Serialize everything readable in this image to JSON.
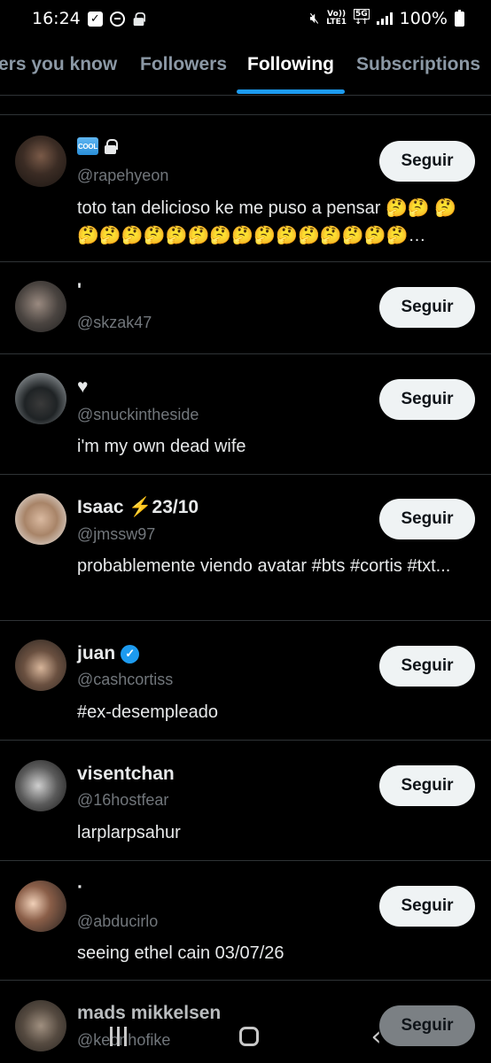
{
  "status_bar": {
    "time": "16:24",
    "lte_top": "Vo))",
    "lte_bottom": "LTE1",
    "network": "5G",
    "battery": "100%"
  },
  "tabs": [
    {
      "label": "ers you know"
    },
    {
      "label": "Followers"
    },
    {
      "label": "Following",
      "active": true
    },
    {
      "label": "Subscriptions"
    }
  ],
  "follow_label": "Seguir",
  "users": [
    {
      "name": "",
      "badge": "COOL",
      "locked": true,
      "handle": "@rapehyeon",
      "bio": "toto tan delicioso ke me puso a pensar 🤔🤔 🤔🤔🤔🤔🤔🤔🤔🤔🤔🤔🤔🤔🤔🤔🤔🤔…"
    },
    {
      "name": "'",
      "handle": "@skzak47",
      "bio": ""
    },
    {
      "name": "♥",
      "handle": "@snuckintheside",
      "bio": "i'm my own dead wife"
    },
    {
      "name": "Isaac ⚡23/10",
      "handle": "@jmssw97",
      "bio": "probablemente viendo avatar #bts #cortis #txt..."
    },
    {
      "name": "juan",
      "verified": true,
      "handle": "@cashcortiss",
      "bio": "#ex-desempleado"
    },
    {
      "name": "visentchan",
      "handle": "@16hostfear",
      "bio": "larplarpsahur"
    },
    {
      "name": "·",
      "handle": "@abducirlo",
      "bio": "seeing ethel cain 03/07/26"
    },
    {
      "name": "mads mikkelsen",
      "handle": "@keonhofike",
      "bio": ""
    }
  ],
  "colors": {
    "accent": "#1d9bf0",
    "background": "#000000",
    "secondary_text": "#71767b"
  }
}
